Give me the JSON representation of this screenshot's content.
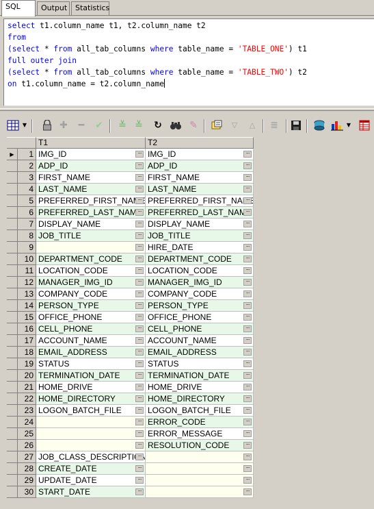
{
  "tabs": [
    {
      "label": "SQL",
      "active": true
    },
    {
      "label": "Output",
      "active": false
    },
    {
      "label": "Statistics",
      "active": false
    }
  ],
  "sql_lines": [
    [
      {
        "t": "select",
        "k": "kw"
      },
      {
        "t": " t1.column_name t1, t2.column_name t2",
        "k": ""
      }
    ],
    [
      {
        "t": "from",
        "k": "kw"
      }
    ],
    [
      {
        "t": "(select",
        "k": "kw"
      },
      {
        "t": " * ",
        "k": ""
      },
      {
        "t": "from",
        "k": "kw"
      },
      {
        "t": " all_tab_columns ",
        "k": ""
      },
      {
        "t": "where",
        "k": "kw"
      },
      {
        "t": " table_name = ",
        "k": ""
      },
      {
        "t": "'TABLE_ONE'",
        "k": "str"
      },
      {
        "t": ") t1",
        "k": ""
      }
    ],
    [
      {
        "t": "full outer join",
        "k": "kw"
      }
    ],
    [
      {
        "t": "(select",
        "k": "kw"
      },
      {
        "t": " * ",
        "k": ""
      },
      {
        "t": "from",
        "k": "kw"
      },
      {
        "t": " all_tab_columns ",
        "k": ""
      },
      {
        "t": "where",
        "k": "kw"
      },
      {
        "t": " table_name = ",
        "k": ""
      },
      {
        "t": "'TABLE_TWO'",
        "k": "str"
      },
      {
        "t": ") t2",
        "k": ""
      }
    ],
    [
      {
        "t": "on",
        "k": "kw"
      },
      {
        "t": " t1.column_name = t2.column_name",
        "k": ""
      }
    ]
  ],
  "toolbar": {
    "icons": [
      "grid-view-icon",
      "dropdown-arrow-icon",
      "lock-icon",
      "add-record-icon",
      "delete-record-icon",
      "post-edit-icon",
      "fetch-next-icon",
      "fetch-last-icon",
      "refresh-icon",
      "find-icon",
      "clear-icon",
      "query-by-example-icon",
      "sort-desc-icon",
      "sort-asc-icon",
      "filter-icon",
      "save-icon",
      "export-icon",
      "chart-icon",
      "chart-dropdown-icon",
      "table-icon"
    ]
  },
  "grid": {
    "columns": [
      "T1",
      "T2"
    ],
    "rows": [
      [
        "IMG_ID",
        "IMG_ID"
      ],
      [
        "ADP_ID",
        "ADP_ID"
      ],
      [
        "FIRST_NAME",
        "FIRST_NAME"
      ],
      [
        "LAST_NAME",
        "LAST_NAME"
      ],
      [
        "PREFERRED_FIRST_NAME",
        "PREFERRED_FIRST_NAME"
      ],
      [
        "PREFERRED_LAST_NAME",
        "PREFERRED_LAST_NAME"
      ],
      [
        "DISPLAY_NAME",
        "DISPLAY_NAME"
      ],
      [
        "JOB_TITLE",
        "JOB_TITLE"
      ],
      [
        "",
        "HIRE_DATE"
      ],
      [
        "DEPARTMENT_CODE",
        "DEPARTMENT_CODE"
      ],
      [
        "LOCATION_CODE",
        "LOCATION_CODE"
      ],
      [
        "MANAGER_IMG_ID",
        "MANAGER_IMG_ID"
      ],
      [
        "COMPANY_CODE",
        "COMPANY_CODE"
      ],
      [
        "PERSON_TYPE",
        "PERSON_TYPE"
      ],
      [
        "OFFICE_PHONE",
        "OFFICE_PHONE"
      ],
      [
        "CELL_PHONE",
        "CELL_PHONE"
      ],
      [
        "ACCOUNT_NAME",
        "ACCOUNT_NAME"
      ],
      [
        "EMAIL_ADDRESS",
        "EMAIL_ADDRESS"
      ],
      [
        "STATUS",
        "STATUS"
      ],
      [
        "TERMINATION_DATE",
        "TERMINATION_DATE"
      ],
      [
        "HOME_DRIVE",
        "HOME_DRIVE"
      ],
      [
        "HOME_DIRECTORY",
        "HOME_DIRECTORY"
      ],
      [
        "LOGON_BATCH_FILE",
        "LOGON_BATCH_FILE"
      ],
      [
        "",
        "ERROR_CODE"
      ],
      [
        "",
        "ERROR_MESSAGE"
      ],
      [
        "",
        "RESOLUTION_CODE"
      ],
      [
        "JOB_CLASS_DESCRIPTION",
        ""
      ],
      [
        "CREATE_DATE",
        ""
      ],
      [
        "UPDATE_DATE",
        ""
      ],
      [
        "START_DATE",
        ""
      ]
    ],
    "current_row": 1,
    "ellipsis": "···"
  }
}
